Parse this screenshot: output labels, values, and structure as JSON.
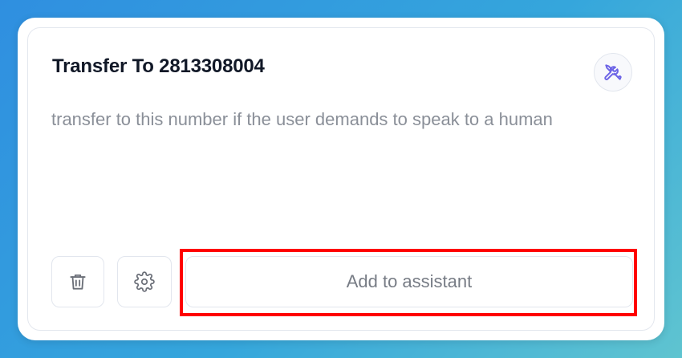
{
  "card": {
    "title": "Transfer To 2813308004",
    "description": "transfer to this number if the user demands to speak to a human",
    "tool_icon": "tools-icon",
    "tool_icon_color": "#6c63e6"
  },
  "actions": {
    "delete_icon": "trash-icon",
    "settings_icon": "gear-icon",
    "add_label": "Add to assistant"
  },
  "highlight": {
    "color": "#ff0000"
  }
}
